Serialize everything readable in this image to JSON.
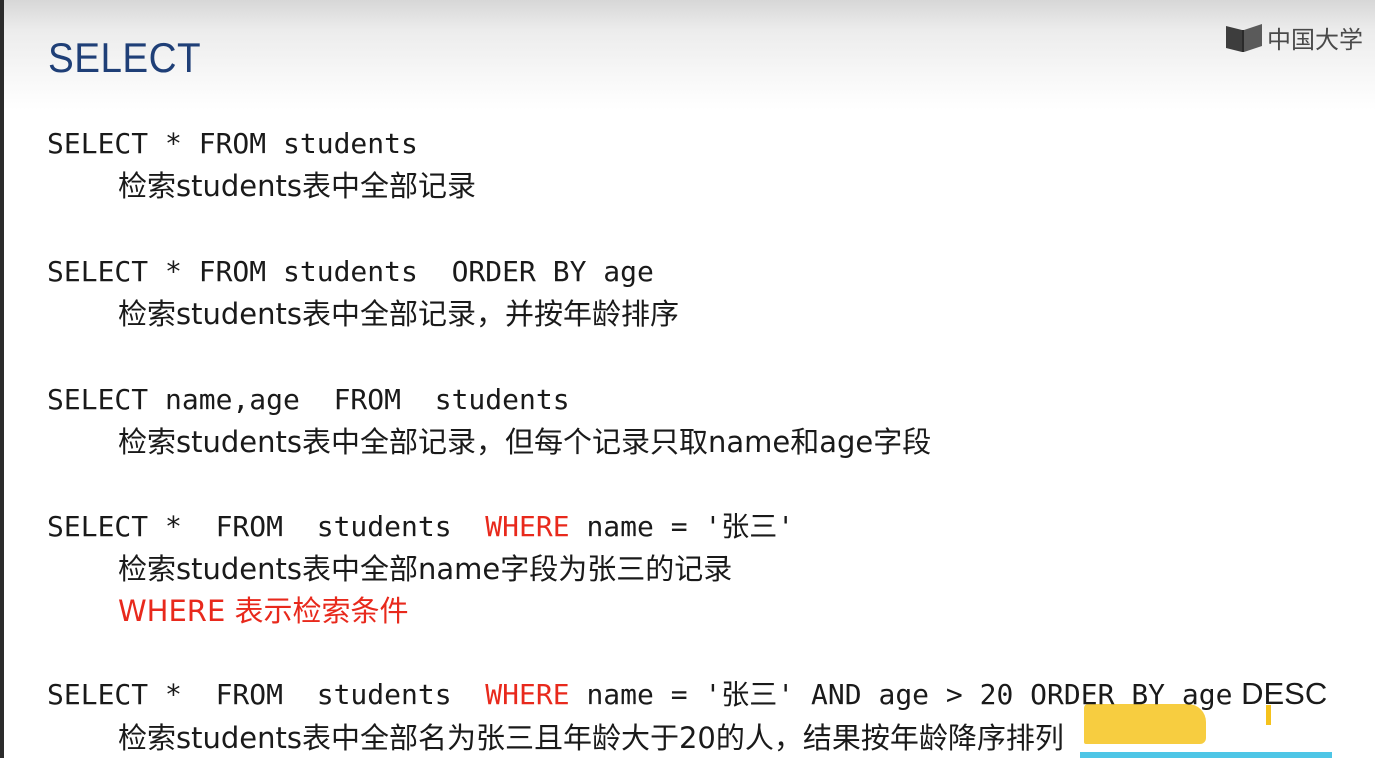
{
  "slide": {
    "title": "SELECT",
    "logo_text": "中国大学"
  },
  "colors": {
    "title": "#1f3f77",
    "keyword_red": "#e8291c",
    "highlight": "#f6c41e",
    "accent": "#4ec6e6"
  },
  "examples": [
    {
      "code": "SELECT * FROM students",
      "desc": "检索students表中全部记录"
    },
    {
      "code": "SELECT * FROM students  ORDER BY age",
      "desc": "检索students表中全部记录，并按年龄排序"
    },
    {
      "code": "SELECT name,age  FROM  students",
      "desc": "检索students表中全部记录，但每个记录只取name和age字段"
    },
    {
      "code_pre": "SELECT *  FROM  students  ",
      "code_kw": "WHERE",
      "code_post": " name = '张三'",
      "desc": "检索students表中全部name字段为张三的记录",
      "note": "WHERE 表示检索条件"
    },
    {
      "code_pre": "SELECT *  FROM  students  ",
      "code_kw": "WHERE",
      "code_post": " name = '张三' AND age > 20 ORDER BY age",
      "code_tail": "DESC",
      "desc": "检索students表中全部名为张三且年龄大于20的人，结果按年龄降序排列"
    }
  ]
}
